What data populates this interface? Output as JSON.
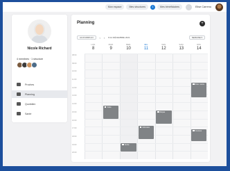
{
  "topbar": {
    "links": [
      "Mon espace",
      "Mes structures",
      "Mes bénéficiaires"
    ],
    "notification_count": "1",
    "user_name": "Elise Carreno"
  },
  "profile": {
    "name": "Nicole Richard",
    "members_label": "4 membres · 1 structure",
    "member_colors": [
      "#7a5a3e",
      "#3b3b3b",
      "#c9905c",
      "#4d6d8a"
    ],
    "nav": [
      {
        "label": "Proches",
        "active": false
      },
      {
        "label": "Planning",
        "active": true
      },
      {
        "label": "Quotidien",
        "active": false
      },
      {
        "label": "Santé",
        "active": false
      }
    ]
  },
  "planning": {
    "title": "Planning",
    "add_label": "+",
    "today_label": "AUJOURD'HUI",
    "prev": "‹",
    "next": "›",
    "range": "8-14 DÉCEMBRE 2021",
    "view": "SEMAINE ▾",
    "days": [
      {
        "name": "LUN.",
        "num": "8"
      },
      {
        "name": "MAR.",
        "num": "9"
      },
      {
        "name": "MER.",
        "num": "10"
      },
      {
        "name": "JEU.",
        "num": "11",
        "today": true
      },
      {
        "name": "VEN.",
        "num": "12"
      },
      {
        "name": "SAM.",
        "num": "13"
      },
      {
        "name": "DIM.",
        "num": "14"
      }
    ],
    "hours": [
      "08:00",
      "09:00",
      "10:00",
      "11:00",
      "12:00",
      "13:00",
      "14:00",
      "15:00",
      "16:00",
      "17:00",
      "18:00",
      "19:00",
      "20:00"
    ],
    "events": [
      {
        "day": 6,
        "start": 11.6,
        "end": 13.4,
        "title": "Kiné / soins"
      },
      {
        "day": 1,
        "start": 14.4,
        "end": 16.0,
        "title": "Visite"
      },
      {
        "day": 4,
        "start": 15.0,
        "end": 16.6,
        "title": "Repas"
      },
      {
        "day": 3,
        "start": 16.9,
        "end": 18.5,
        "title": "Infirmière"
      },
      {
        "day": 6,
        "start": 17.3,
        "end": 18.8,
        "title": "Courses"
      },
      {
        "day": 2,
        "start": 19.0,
        "end": 20.1,
        "title": "Sortie"
      }
    ]
  }
}
